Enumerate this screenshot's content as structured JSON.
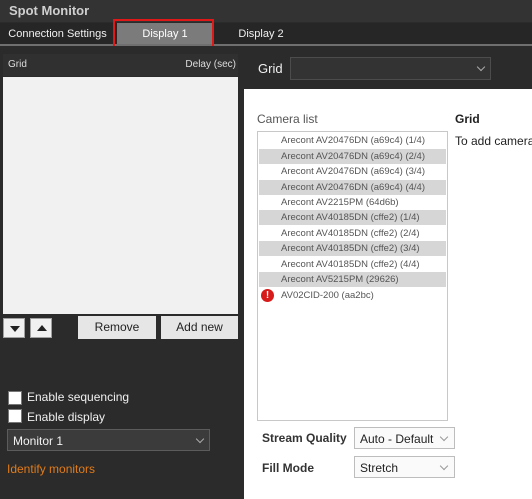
{
  "window": {
    "title": "Spot Monitor"
  },
  "tabs": [
    {
      "label": "Connection Settings"
    },
    {
      "label": "Display 1"
    },
    {
      "label": "Display 2"
    }
  ],
  "grid_list": {
    "header_grid": "Grid",
    "header_delay": "Delay (sec)",
    "rows": []
  },
  "buttons": {
    "remove": "Remove",
    "add_new": "Add new"
  },
  "options": {
    "enable_sequencing": {
      "label": "Enable sequencing",
      "checked": false
    },
    "enable_display": {
      "label": "Enable display",
      "checked": false
    }
  },
  "monitor_select": {
    "value": "Monitor 1"
  },
  "identify_link": "Identify monitors",
  "grid_selector": {
    "label": "Grid",
    "value": ""
  },
  "camera_panel": {
    "camera_list_label": "Camera list",
    "grid_label": "Grid",
    "grid_hint": "To add camera",
    "cameras": [
      {
        "name": "Arecont AV20476DN (a69c4) (1/4)",
        "warning": false
      },
      {
        "name": "Arecont AV20476DN (a69c4) (2/4)",
        "warning": false
      },
      {
        "name": "Arecont AV20476DN (a69c4) (3/4)",
        "warning": false
      },
      {
        "name": "Arecont AV20476DN (a69c4) (4/4)",
        "warning": false
      },
      {
        "name": "Arecont AV2215PM (64d6b)",
        "warning": false
      },
      {
        "name": "Arecont AV40185DN (cffe2) (1/4)",
        "warning": false
      },
      {
        "name": "Arecont AV40185DN (cffe2) (2/4)",
        "warning": false
      },
      {
        "name": "Arecont AV40185DN (cffe2) (3/4)",
        "warning": false
      },
      {
        "name": "Arecont AV40185DN (cffe2) (4/4)",
        "warning": false
      },
      {
        "name": "Arecont AV5215PM (29626)",
        "warning": false
      },
      {
        "name": "AV02CID-200  (aa2bc)",
        "warning": true
      }
    ],
    "warning_glyph": "!",
    "stream_quality": {
      "label": "Stream Quality",
      "value": "Auto - Default"
    },
    "fill_mode": {
      "label": "Fill Mode",
      "value": "Stretch"
    }
  },
  "colors": {
    "accent_link": "#e07b1a",
    "highlight_border": "#e01818",
    "warning": "#d71a1a"
  }
}
